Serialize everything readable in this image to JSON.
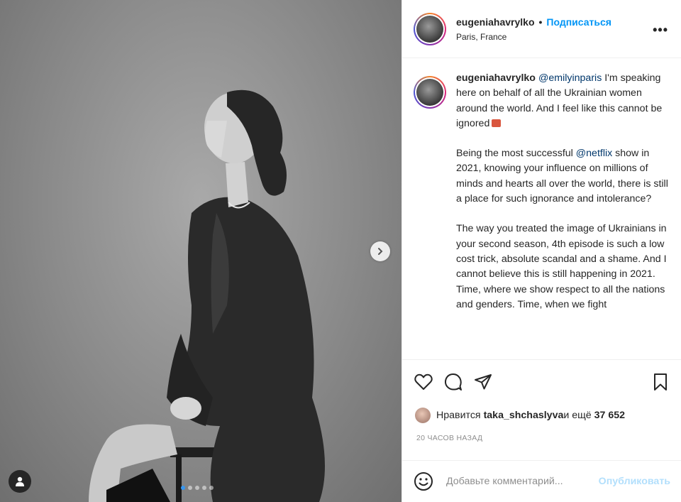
{
  "post": {
    "username": "eugeniahavrylko",
    "follow_label": "Подписаться",
    "location": "Paris, France",
    "more_label": "•••"
  },
  "caption": {
    "username": "eugeniahavrylko",
    "mention1": "@emilyinparis",
    "p1_text": " I'm speaking here on behalf of all the Ukrainian women around the world. And I feel like this cannot be ignored",
    "p2_before": "Being the most successful ",
    "mention2": "@netflix",
    "p2_after": " show in 2021, knowing your influence on millions of minds and hearts all over the world, there is still a place for such ignorance and intolerance?",
    "p3_text": "The way you treated the image of Ukrainians in your second season, 4th episode is such a low cost trick, absolute scandal and a shame. And I cannot believe this is still happening in 2021. Time, where we show respect to all the nations and genders. Time, when we fight"
  },
  "likes": {
    "prefix": "Нравится ",
    "user": "taka_shchaslyva",
    "suffix": " и ещё ",
    "count": "37 652"
  },
  "time_ago": "20 ЧАСОВ НАЗАД",
  "comment": {
    "placeholder": "Добавьте комментарий...",
    "publish_label": "Опубликовать"
  },
  "carousel": {
    "total": 5,
    "active_index": 0
  },
  "icons": [
    "heart-icon",
    "comment-icon",
    "share-icon",
    "bookmark-icon",
    "emoji-icon",
    "chevron-right-icon",
    "user-tag-icon"
  ],
  "colors": {
    "accent": "#0095f6",
    "link": "#00376b",
    "muted": "#8e8e8e"
  }
}
